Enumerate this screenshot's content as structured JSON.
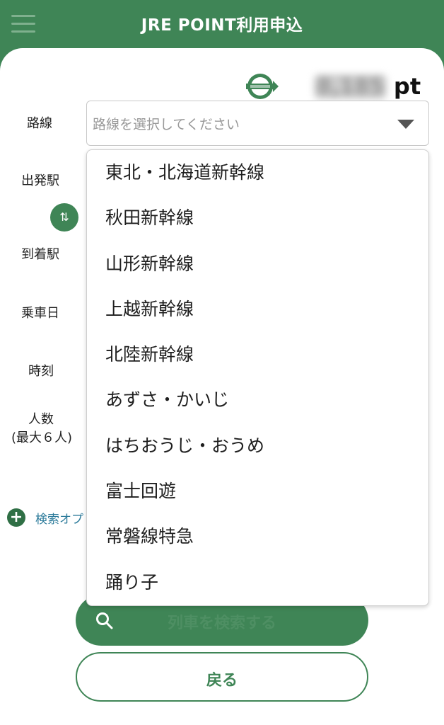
{
  "header": {
    "title": "JRE POINT利用申込"
  },
  "points": {
    "value": "8,185",
    "unit": "pt"
  },
  "form": {
    "route_label": "路線",
    "route_placeholder": "路線を選択してください",
    "departure_label": "出発駅",
    "arrival_label": "到着駅",
    "date_label": "乗車日",
    "time_label": "時刻",
    "people_label": "人数",
    "people_sub": "(最大６人)",
    "search_options": "検索オプ"
  },
  "dropdown": {
    "items": [
      "東北・北海道新幹線",
      "秋田新幹線",
      "山形新幹線",
      "上越新幹線",
      "北陸新幹線",
      "あずさ・かいじ",
      "はちおうじ・おうめ",
      "富士回遊",
      "常磐線特急",
      "踊り子"
    ]
  },
  "buttons": {
    "search_label": "列車を検索する",
    "back_label": "戻る"
  },
  "colors": {
    "brand_green": "#3f8556",
    "link_blue": "#2b7a9a"
  }
}
